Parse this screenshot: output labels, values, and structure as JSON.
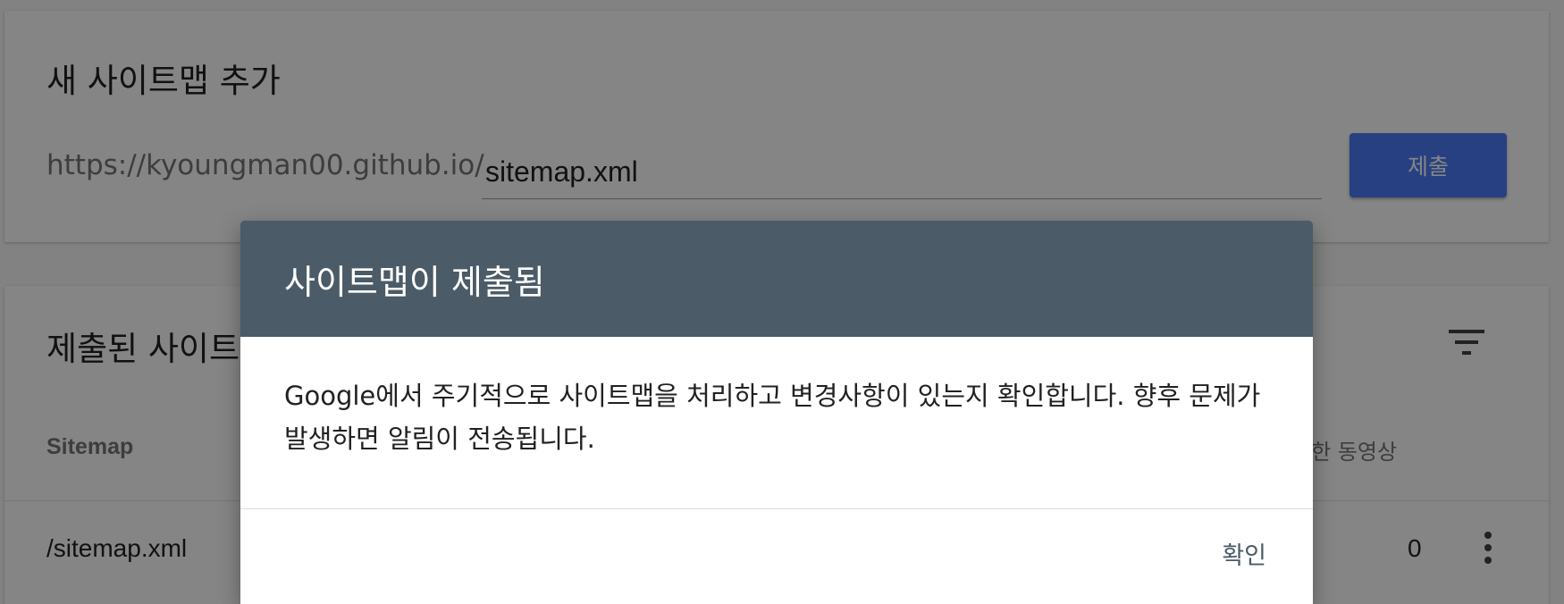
{
  "add_sitemap": {
    "title": "새 사이트맵 추가",
    "url_prefix": "https://kyoungman00.github.io/",
    "input_value": "sitemap.xml",
    "submit_label": "제출"
  },
  "submitted_sitemaps": {
    "title": "제출된 사이트",
    "columns": {
      "sitemap": "Sitemap",
      "videos": "견한 동영상"
    },
    "rows": [
      {
        "path": "/sitemap.xml",
        "count": "0"
      }
    ]
  },
  "dialog": {
    "title": "사이트맵이 제출됨",
    "body": "Google에서 주기적으로 사이트맵을 처리하고 변경사항이 있는지 확인합니다. 향후 문제가 발생하면 알림이 전송됩니다.",
    "confirm_label": "확인"
  },
  "colors": {
    "accent": "#4a7bf7",
    "dialog_header": "#4b5b67",
    "overlay": "rgba(0,0,0,0.48)"
  },
  "icons": [
    "filter-icon",
    "more-vert-icon"
  ]
}
